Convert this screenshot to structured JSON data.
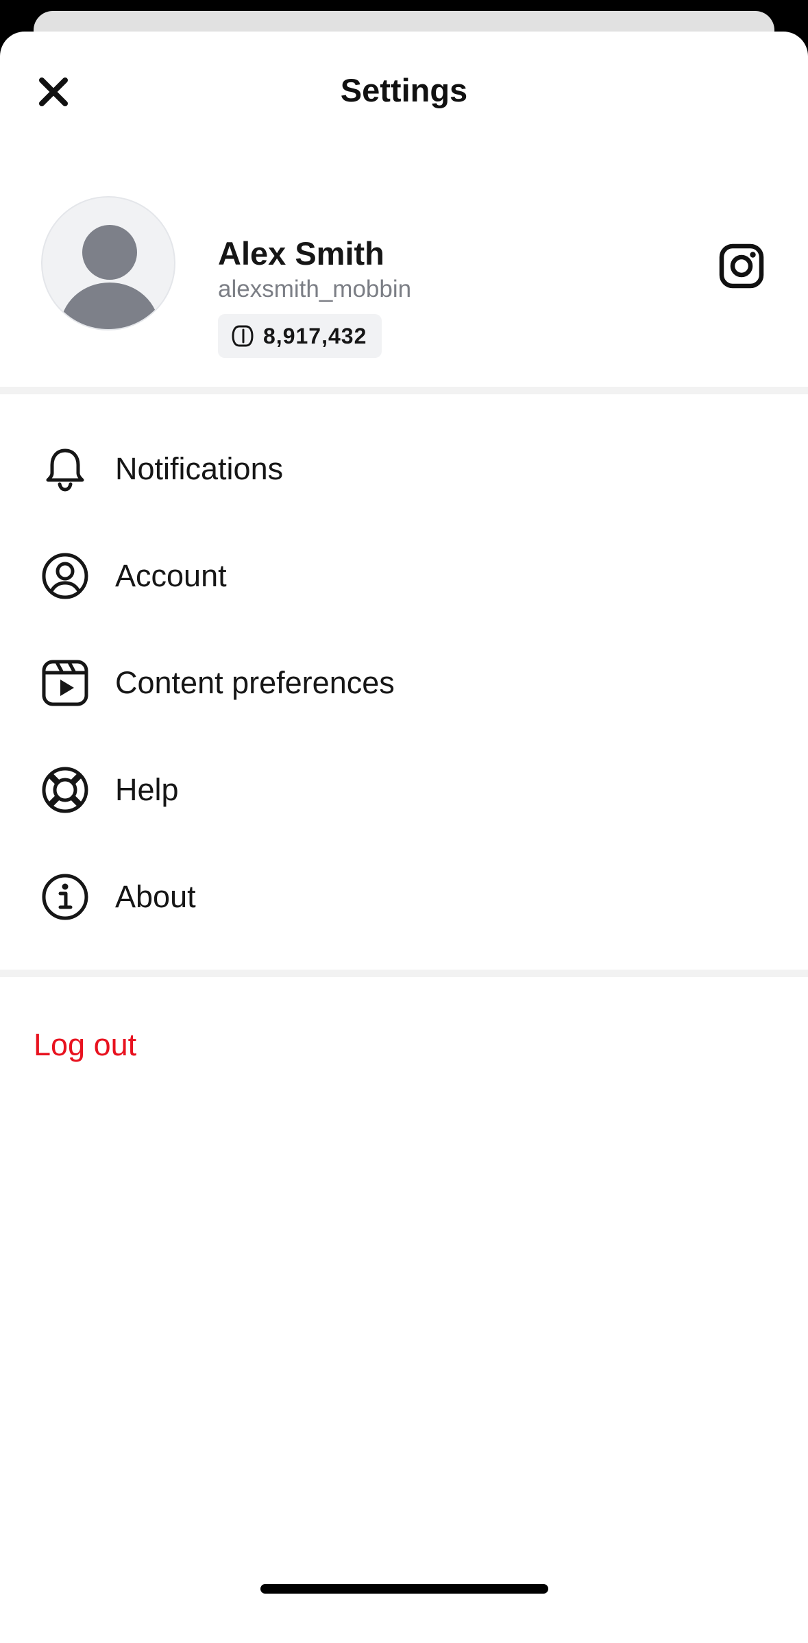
{
  "header": {
    "title": "Settings",
    "close_icon": "close-icon"
  },
  "profile": {
    "name": "Alex Smith",
    "username": "alexsmith_mobbin",
    "coins": "8,917,432",
    "coin_icon": "coin-icon",
    "social_icon": "instagram-icon"
  },
  "menu": {
    "items": [
      {
        "label": "Notifications",
        "icon": "bell-icon"
      },
      {
        "label": "Account",
        "icon": "user-circle-icon"
      },
      {
        "label": "Content preferences",
        "icon": "video-clip-icon"
      },
      {
        "label": "Help",
        "icon": "lifebuoy-icon"
      },
      {
        "label": "About",
        "icon": "info-icon"
      }
    ]
  },
  "logout": {
    "label": "Log out",
    "color": "#e8121f"
  },
  "colors": {
    "background": "#ffffff",
    "divider": "#f2f2f2",
    "secondary_text": "#7b7e85",
    "badge_background": "#f1f2f4"
  }
}
